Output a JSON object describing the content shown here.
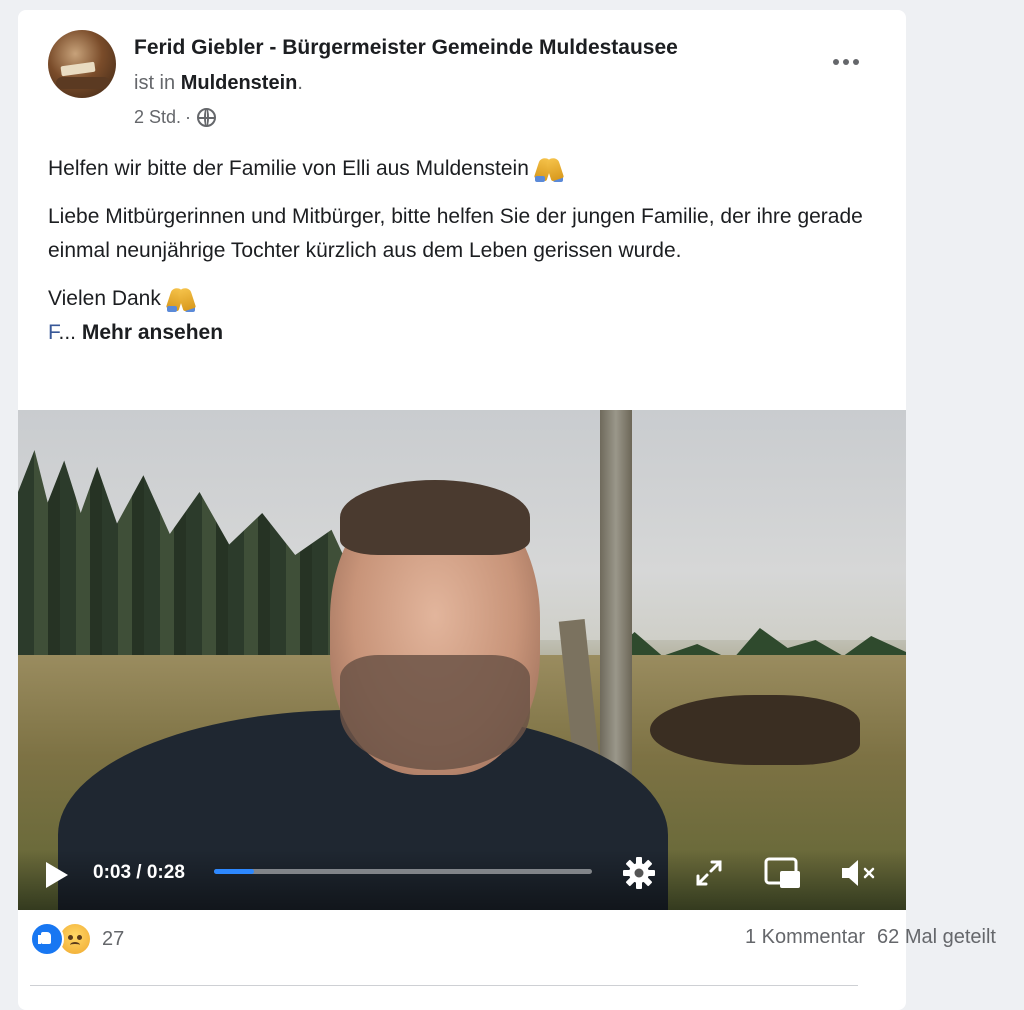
{
  "post": {
    "author": "Ferid Giebler - Bürgermeister Gemeinde Muldestausee",
    "location_prefix": "ist in",
    "location": "Muldenstein",
    "location_suffix": ".",
    "time": "2 Std.",
    "time_separator": "·",
    "audience_icon": "globe-icon",
    "paragraph1": "Helfen wir bitte der Familie von Elli aus Muldenstein",
    "paragraph2": "Liebe Mitbürgerinnen und Mitbürger, bitte helfen Sie der jungen Familie, der ihre gerade einmal neunjährige Tochter kürzlich aus dem Leben gerissen wurde.",
    "paragraph3": "Vielen Dank",
    "truncated_link": "F",
    "ellipsis": "...",
    "see_more": "Mehr ansehen"
  },
  "video": {
    "current_time": "0:03",
    "duration": "0:28",
    "time_display": "0:03 / 0:28",
    "progress_fraction": 0.107
  },
  "footer": {
    "reaction_icons": [
      "like-icon",
      "sad-icon"
    ],
    "reaction_count": "27",
    "comments": "1 Kommentar",
    "shares": "62 Mal geteilt"
  },
  "colors": {
    "accent": "#1877f2",
    "progress": "#2d88ff",
    "secondary_text": "#65676b",
    "link": "#385898"
  }
}
